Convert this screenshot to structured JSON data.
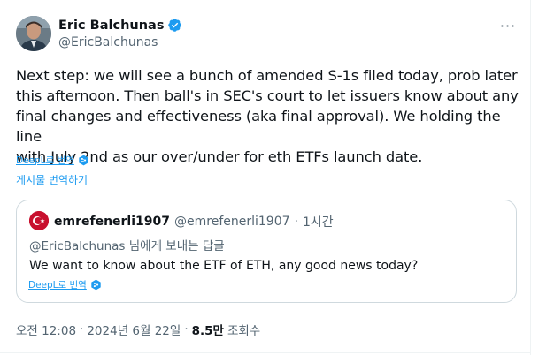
{
  "author": {
    "name": "Eric Balchunas",
    "handle": "@EricBalchunas",
    "verified": true
  },
  "menu": {
    "more_label": "···"
  },
  "tweet": {
    "lines": [
      "Next step: we will see a bunch of amended S-1s filed today, prob later",
      "this afternoon. Then ball's in SEC's court to let issuers know about any",
      "final changes and effectiveness (aka final approval). We holding the line",
      "with July 2nd as our over/under for eth ETFs launch date."
    ],
    "deepl_label": "DeepL로 번역",
    "translate_label": "게시물 번역하기"
  },
  "quote": {
    "name": "emrefenerli1907",
    "handle": "@emrefenerli1907",
    "separator": "·",
    "time": "1시간",
    "reply_to": "@EricBalchunas 님에게 보내는 답글",
    "text": "We want to know about the ETF of ETH, any good news today?",
    "deepl_label": "DeepL로 번역"
  },
  "meta": {
    "time": "오전 12:08",
    "sep1": "·",
    "date": "2024년 6월 22일",
    "sep2": "·",
    "views_count": "8.5만",
    "views_label": "조회수"
  },
  "colors": {
    "accent": "#1d9bf0",
    "secondary_text": "#536471",
    "primary_text": "#0f1419",
    "border": "#cfd9de"
  },
  "icons": {
    "verified": "verified-badge-icon",
    "deepl": "deepl-icon",
    "more": "more-options-icon",
    "quote_avatar": "turkish-flag-avatar"
  }
}
